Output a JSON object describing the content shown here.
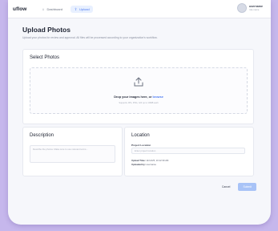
{
  "app": {
    "logo": "uflow"
  },
  "nav": [
    {
      "label": "Dashboard",
      "icon": "home-icon",
      "active": false
    },
    {
      "label": "Upload",
      "icon": "upload-icon",
      "active": true
    }
  ],
  "user": {
    "name": "username",
    "sub": "role name"
  },
  "header": {
    "title": "Upload Photos",
    "subtitle": "Upload your photos for review and approval. All files will be processed according to your organization's workflow."
  },
  "select_photos": {
    "title": "Select Photos",
    "drop_text": "Drop your images here, or ",
    "browse": "browse",
    "hint": "Supports JPG, PNG, GIF up to 10MB each"
  },
  "description": {
    "title": "Description",
    "placeholder": "Describe the photos. Make sure to use relevant terms..."
  },
  "location": {
    "title": "Location",
    "project_label": "Project Location",
    "project_placeholder": "Enter project location",
    "upload_time_label": "Upload Time:",
    "upload_time_value": "11/12/25, 10:12:30 AM",
    "uploaded_by_label": "Uploaded by:",
    "uploaded_by_value": "username"
  },
  "actions": {
    "cancel": "Cancel",
    "submit": "Submit"
  },
  "colors": {
    "accent": "#4f7cf2",
    "submit_disabled": "#a8c3f7",
    "frame": "#c6b7ec"
  }
}
